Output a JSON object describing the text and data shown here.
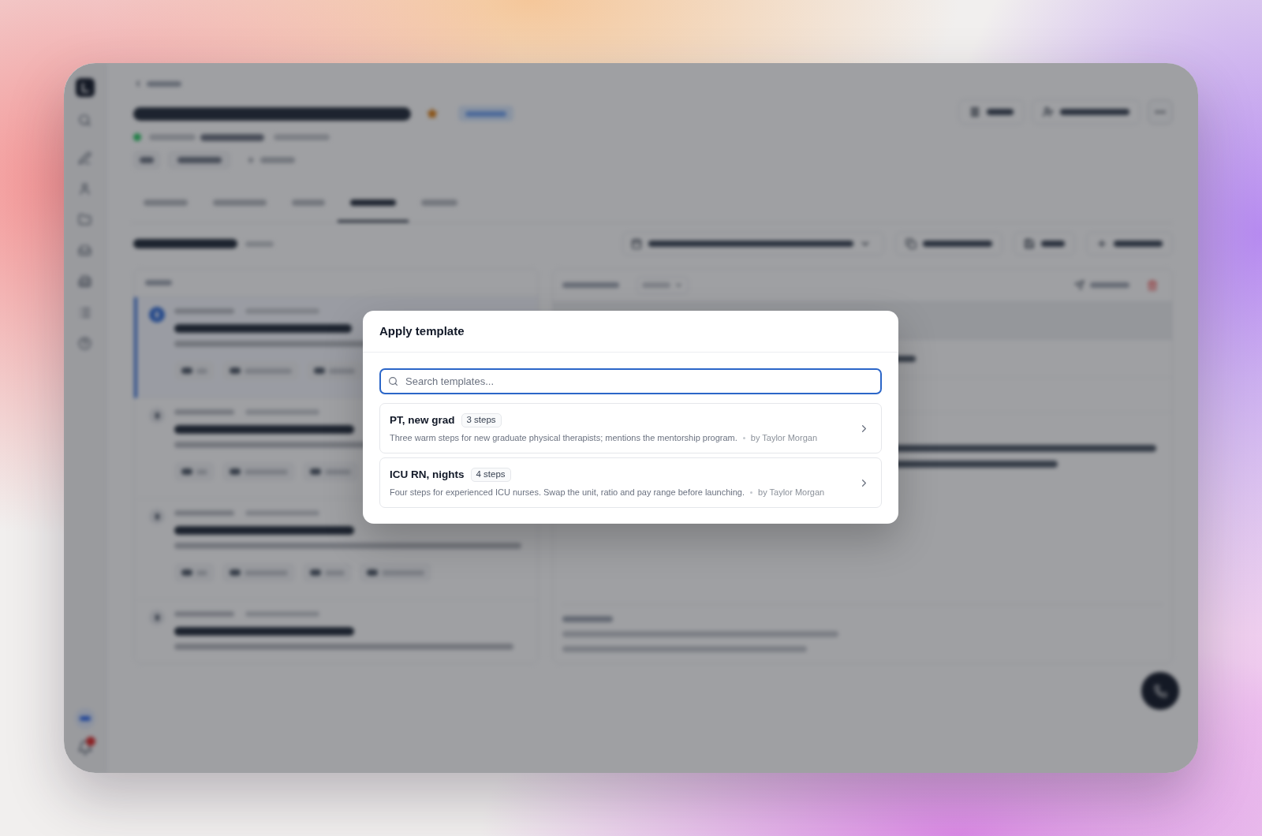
{
  "background_page": {
    "starred": true,
    "notification": true,
    "tabs": [
      {
        "selected": false
      },
      {
        "selected": false
      },
      {
        "selected": false
      },
      {
        "selected": true
      },
      {
        "selected": false
      }
    ],
    "steps": [
      {
        "selected": true
      },
      {
        "selected": false
      },
      {
        "selected": false
      },
      {
        "selected": false
      }
    ]
  },
  "dialog": {
    "title": "Apply template",
    "search": {
      "placeholder": "Search templates...",
      "focused": true
    },
    "templates": [
      {
        "name": "PT, new grad",
        "steps": "3 steps",
        "description": "Three warm steps for new graduate physical therapists; mentions the mentorship program.",
        "author": "by Taylor Morgan"
      },
      {
        "name": "ICU RN, nights",
        "steps": "4 steps",
        "description": "Four steps for experienced ICU nurses. Swap the unit, ratio and pay range before launching.",
        "author": "by Taylor Morgan"
      }
    ]
  }
}
